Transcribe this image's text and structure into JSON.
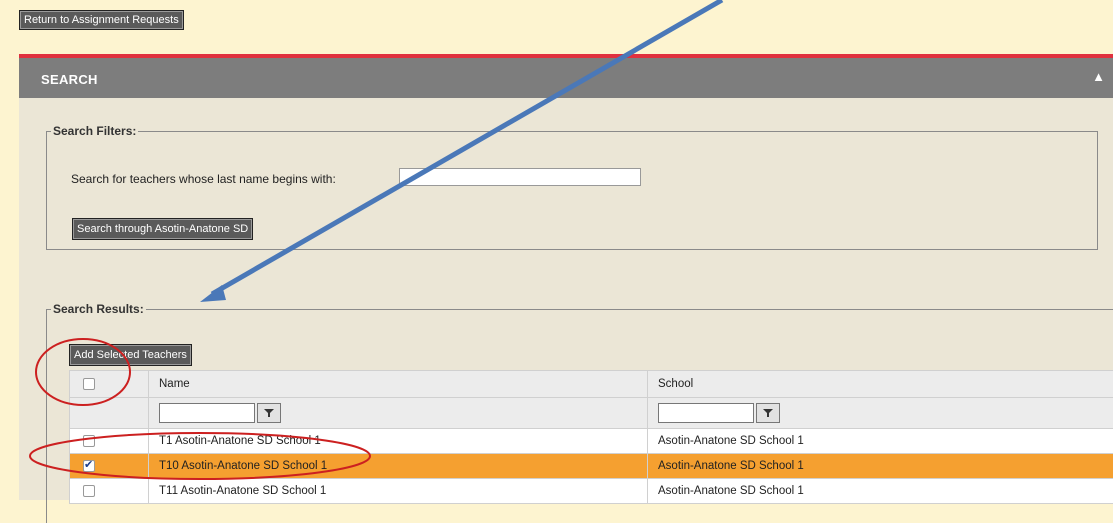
{
  "return_button": "Return to Assignment Requests",
  "panel": {
    "title": "SEARCH"
  },
  "filters": {
    "legend": "Search Filters:",
    "label": "Search for teachers whose last name begins with:",
    "input_value": "",
    "search_button": "Search through Asotin-Anatone SD"
  },
  "results": {
    "legend": "Search Results:",
    "add_button": "Add Selected Teachers",
    "columns": {
      "name": "Name",
      "school": "School"
    },
    "rows": [
      {
        "name": "T1 Asotin-Anatone SD School 1",
        "school": "Asotin-Anatone SD School 1",
        "checked": false
      },
      {
        "name": "T10 Asotin-Anatone SD School 1",
        "school": "Asotin-Anatone SD School 1",
        "checked": true
      },
      {
        "name": "T11 Asotin-Anatone SD School 1",
        "school": "Asotin-Anatone SD School 1",
        "checked": false
      }
    ]
  },
  "colors": {
    "accent_red": "#e0303e",
    "selected_row": "#f5a030",
    "arrow": "#4a78b8",
    "annotation_circle": "#cc2020"
  }
}
